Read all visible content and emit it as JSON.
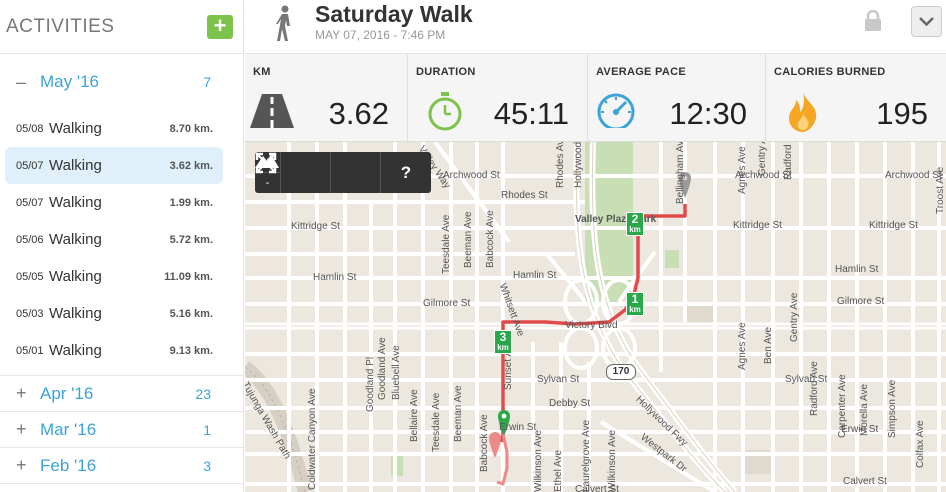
{
  "sidebar": {
    "title": "ACTIVITIES",
    "add_label": "+",
    "open_month": {
      "toggle": "–",
      "name": "May '16",
      "count": "7"
    },
    "activities": [
      {
        "date": "05/08",
        "type": "Walking",
        "distance": "8.70 km."
      },
      {
        "date": "05/07",
        "type": "Walking",
        "distance": "3.62 km."
      },
      {
        "date": "05/07",
        "type": "Walking",
        "distance": "1.99 km."
      },
      {
        "date": "05/06",
        "type": "Walking",
        "distance": "5.72 km."
      },
      {
        "date": "05/05",
        "type": "Walking",
        "distance": "11.09 km."
      },
      {
        "date": "05/03",
        "type": "Walking",
        "distance": "5.16 km."
      },
      {
        "date": "05/01",
        "type": "Walking",
        "distance": "9.13 km."
      }
    ],
    "selected_index": 1,
    "closed_months": [
      {
        "toggle": "+",
        "name": "Apr '16",
        "count": "23"
      },
      {
        "toggle": "+",
        "name": "Mar '16",
        "count": "1"
      },
      {
        "toggle": "+",
        "name": "Feb '16",
        "count": "3"
      }
    ]
  },
  "header": {
    "title": "Saturday Walk",
    "subtitle": "MAY 07, 2016  -  7:46 PM",
    "icon": "walking-person-icon"
  },
  "stats": [
    {
      "label": "KM",
      "value": "3.62",
      "icon": "road-icon"
    },
    {
      "label": "DURATION",
      "value": "45:11",
      "icon": "stopwatch-icon"
    },
    {
      "label": "AVERAGE PACE",
      "value": "12:30",
      "icon": "speedometer-icon"
    },
    {
      "label": "CALORIES BURNED",
      "value": "195",
      "icon": "flame-icon"
    }
  ],
  "map": {
    "controls": {
      "zoom_in": "+",
      "zoom_out": "-",
      "help": "?"
    },
    "km_markers": [
      {
        "n": "1",
        "unit": "km"
      },
      {
        "n": "2",
        "unit": "km"
      },
      {
        "n": "3",
        "unit": "km"
      }
    ],
    "highway_shield": "170",
    "street_labels": {
      "h": [
        "Archwood St",
        "Kittridge St",
        "Hamlin St",
        "Gilmore St",
        "Victory Blvd",
        "Sylvan St",
        "Debby St",
        "Erwin St",
        "Calvert St",
        "Rhodes St",
        "Archwood St",
        "Kittridge St",
        "Hamlin St",
        "Gilmore St",
        "Sylvan St",
        "Erwin St",
        "Calvert St",
        "Hamlin St",
        "Kittridge St",
        "Archwood St",
        "Valley Plaza Park"
      ],
      "v": [
        "Teesdale Ave",
        "Beeman Ave",
        "Babcock Ave",
        "Goodland Pl",
        "Goodland Ave",
        "Bluebell Ave",
        "Bellaire Ave",
        "Teesdale Ave",
        "Beeman Ave",
        "Babcock Ave",
        "Coldwater Canyon Ave",
        "Sunset Ave",
        "Wilkinson Ave",
        "Agnes Ave",
        "Ben Ave",
        "Gentry Ave",
        "Radford Ave",
        "Carpenter Ave",
        "Morella Ave",
        "Simpson Ave",
        "Colfax Ave",
        "Troost Ave",
        "Rhodes Ave",
        "Hollywood Fwy",
        "Ethel Ave",
        "Laurelgrove Ave",
        "Wilkinson Ave",
        "Agnes Ave",
        "Gentry Ave",
        "Radford Ave",
        "Bellingham Ave"
      ],
      "d": [
        "Whitsett Ave",
        "Westpark Dr",
        "Hollywood Fwy",
        "Tujunga Wash Path",
        "Valley Way"
      ]
    }
  },
  "colors": {
    "accent": "#3ba3d8",
    "add_button": "#7dc24a",
    "route": "#e24a4a",
    "km_marker": "#29a84a",
    "park": "#c8dfb6",
    "stopwatch": "#7dc24a",
    "speedometer": "#3ba3d8",
    "flame": "#f5a623"
  }
}
